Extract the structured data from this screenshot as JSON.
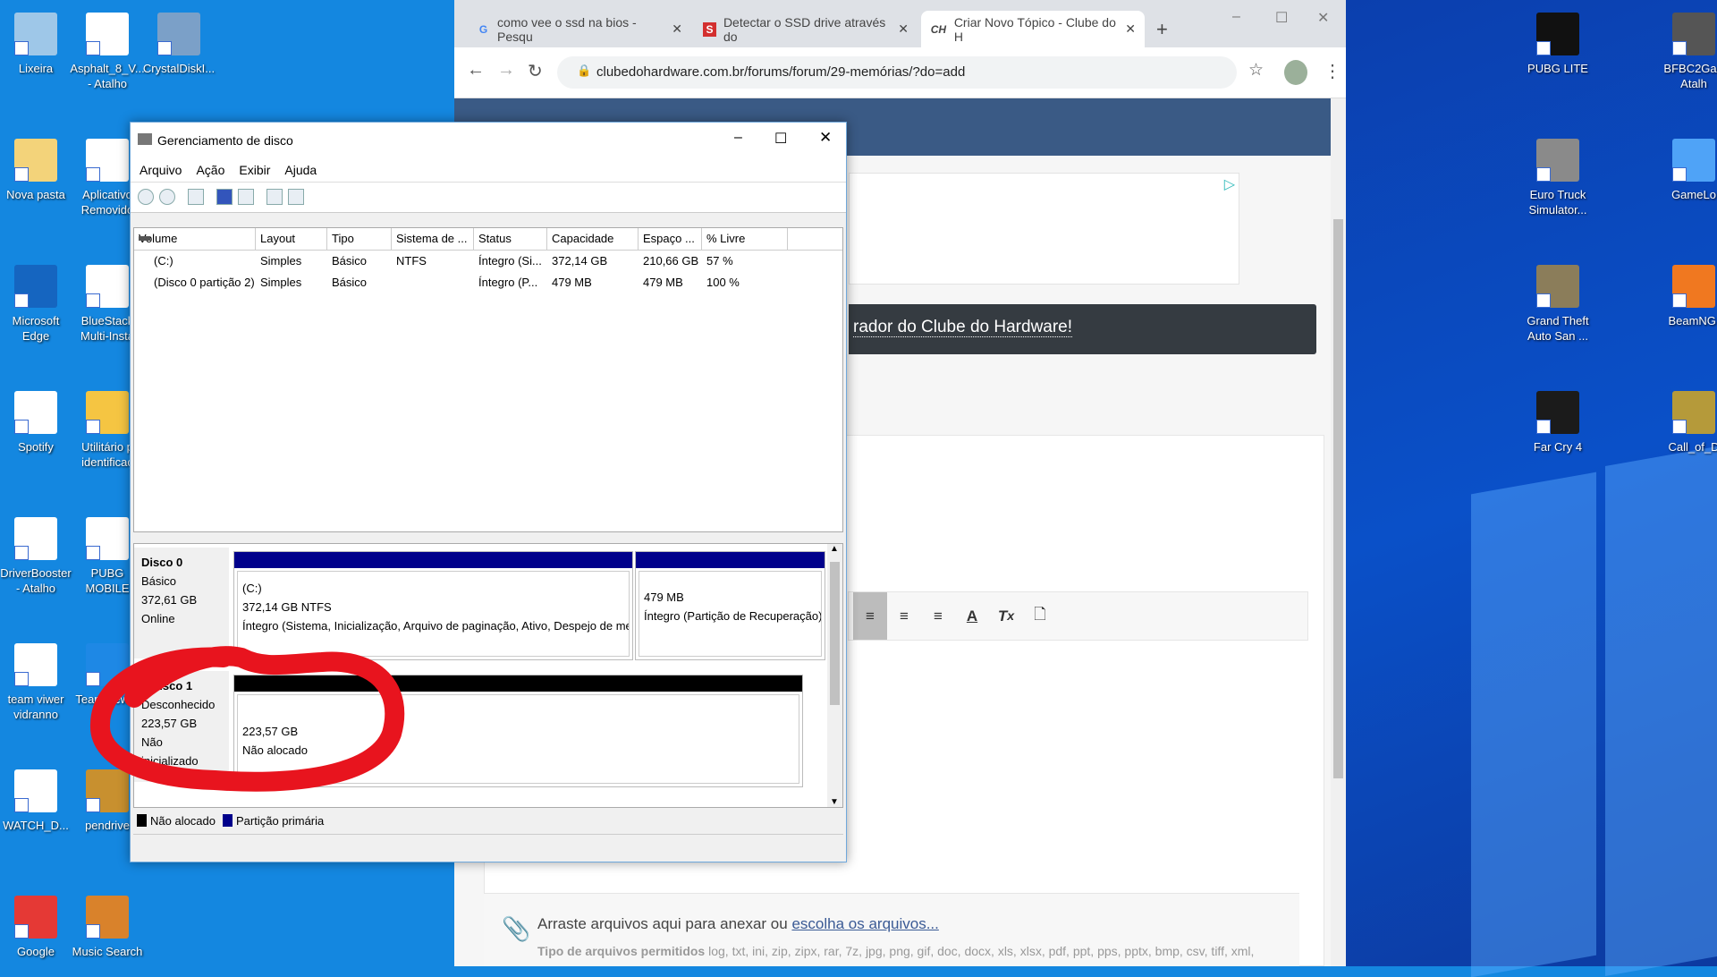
{
  "desktop": {
    "left_icons": [
      {
        "label": "Lixeira",
        "color": "#9ec7e8"
      },
      {
        "label": "Asphalt_8_V... - Atalho",
        "color": "#ffffff"
      },
      {
        "label": "CrystalDiskI...",
        "color": "#7ba0c8"
      },
      {
        "label": "Nova pasta",
        "color": "#f3d37a"
      },
      {
        "label": "Aplicativo Removido",
        "color": "#ffffff"
      },
      {
        "label": "Microsoft Edge",
        "color": "#1565c0"
      },
      {
        "label": "BlueStack Multi-Insta",
        "color": "#ffffff"
      },
      {
        "label": "Spotify",
        "color": "#ffffff"
      },
      {
        "label": "Utilitário p identificaç",
        "color": "#f5c542"
      },
      {
        "label": "DriverBooster - Atalho",
        "color": "#ffffff"
      },
      {
        "label": "PUBG MOBILE",
        "color": "#ffffff"
      },
      {
        "label": "team viwer vidranno",
        "color": "#ffffff"
      },
      {
        "label": "TeamViewer",
        "color": "#1e88e5"
      },
      {
        "label": "WATCH_D...",
        "color": "#ffffff"
      },
      {
        "label": "pendrive",
        "color": "#c8902f"
      },
      {
        "label": "Google",
        "color": "#e53935"
      },
      {
        "label": "Music Search",
        "color": "#d9822b"
      }
    ],
    "right_icons": [
      {
        "label": "PUBG LITE",
        "color": "#111111"
      },
      {
        "label": "BFBC2Ga - Atalh",
        "color": "#555555"
      },
      {
        "label": "Euro Truck Simulator...",
        "color": "#8a8a8a"
      },
      {
        "label": "GameLo",
        "color": "#4fa3f7"
      },
      {
        "label": "Grand Theft Auto San ...",
        "color": "#8b7d5a"
      },
      {
        "label": "BeamNG.",
        "color": "#f07820"
      },
      {
        "label": "Far Cry 4",
        "color": "#1b1b1b"
      },
      {
        "label": "Call_of_D",
        "color": "#b59a3a"
      }
    ]
  },
  "browser": {
    "tabs": [
      {
        "title": "como vee o ssd na bios - Pesqu",
        "favicon": "G"
      },
      {
        "title": "Detectar o SSD drive através do",
        "favicon": "S"
      },
      {
        "title": "Criar Novo Tópico - Clube do H",
        "favicon": "CH",
        "active": true
      }
    ],
    "new_tab": "+",
    "url": "clubedohardware.com.br/forums/forum/29-memórias/?do=add",
    "banner_text": "rador do Clube do Hardware!",
    "attach_text": "Arraste arquivos aqui para anexar ou ",
    "attach_link": "escolha os arquivos...",
    "allowed_label": "Tipo de arquivos permitidos",
    "allowed_types": " log, txt, ini, zip, zipx, rar, 7z, jpg, png, gif, doc, docx, xls, xlsx, pdf, ppt, pps, pptx, bmp, csv, tiff, xml,"
  },
  "diskmgmt": {
    "title": "Gerenciamento de disco",
    "menu": [
      "Arquivo",
      "Ação",
      "Exibir",
      "Ajuda"
    ],
    "columns": [
      "Volume",
      "Layout",
      "Tipo",
      "Sistema de ...",
      "Status",
      "Capacidade",
      "Espaço ...",
      "% Livre"
    ],
    "rows": [
      [
        "(C:)",
        "Simples",
        "Básico",
        "NTFS",
        "Íntegro (Si...",
        "372,14 GB",
        "210,66 GB",
        "57 %"
      ],
      [
        "(Disco 0 partição 2)",
        "Simples",
        "Básico",
        "",
        "Íntegro (P...",
        "479 MB",
        "479 MB",
        "100 %"
      ]
    ],
    "disk0": {
      "name": "Disco 0",
      "type": "Básico",
      "size": "372,61 GB",
      "state": "Online",
      "p1": {
        "name": "(C:)",
        "size": "372,14 GB NTFS",
        "status": "Íntegro (Sistema, Inicialização, Arquivo de paginação, Ativo, Despejo de mem"
      },
      "p2": {
        "size": "479 MB",
        "status": "Íntegro (Partição de Recuperação)"
      }
    },
    "disk1": {
      "name": "Disco 1",
      "type": "Desconhecido",
      "size": "223,57 GB",
      "state": "Não inicializado",
      "p1": {
        "size": "223,57 GB",
        "status": "Não alocado"
      }
    },
    "legend": [
      {
        "label": "Não alocado",
        "color": "#000000"
      },
      {
        "label": "Partição primária",
        "color": "#00008b"
      }
    ]
  },
  "annotation_color": "#e8141e"
}
